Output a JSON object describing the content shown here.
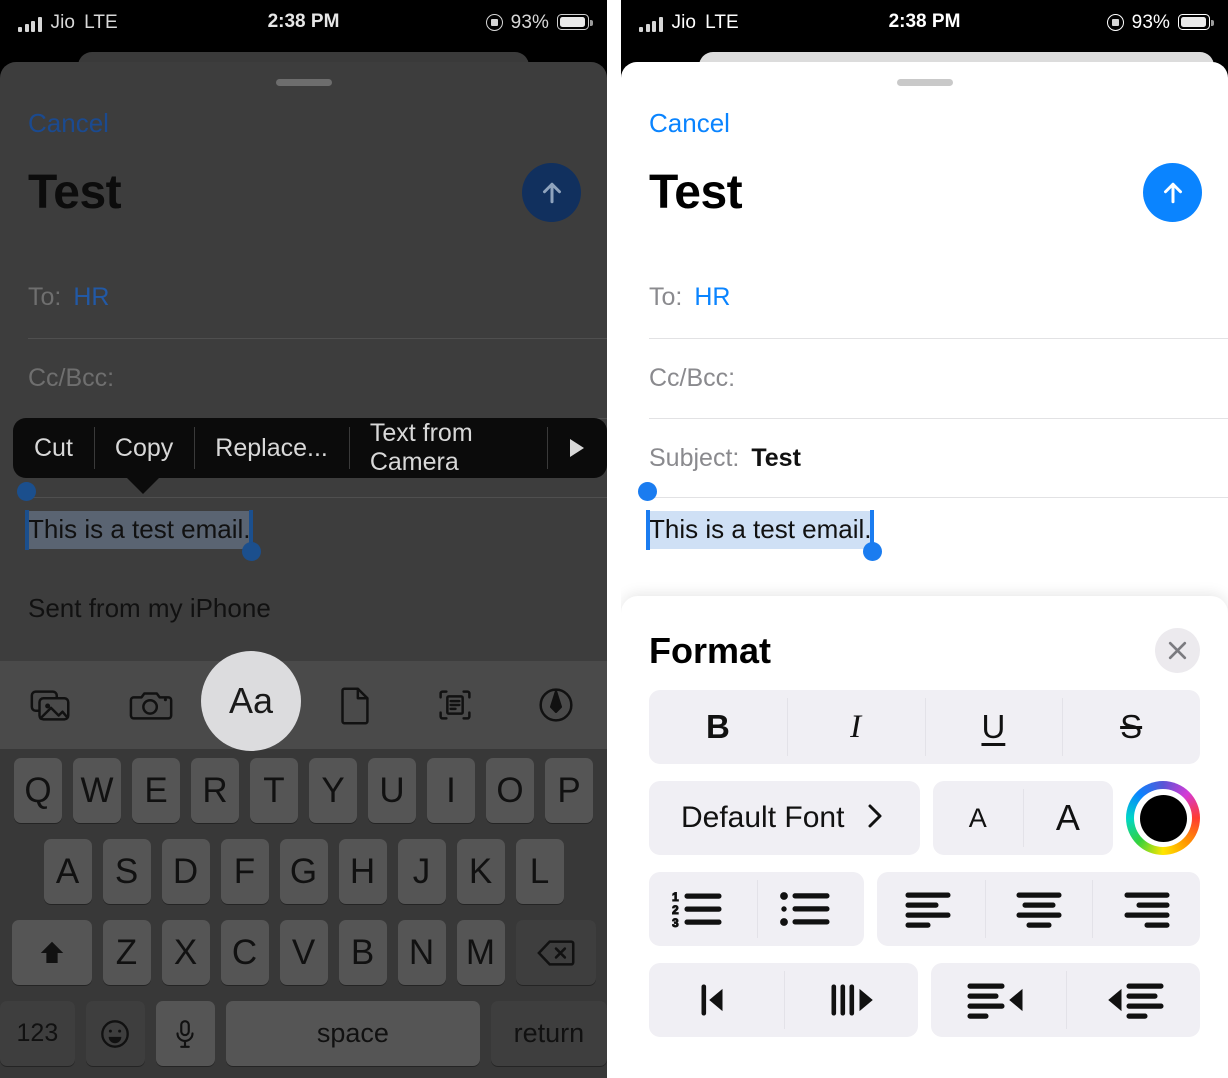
{
  "status_bar": {
    "carrier": "Jio",
    "network": "LTE",
    "time": "2:38 PM",
    "battery_percent": "93%",
    "signal_icon": "cellular-bars-icon",
    "orientation_icon": "rotation-lock-icon",
    "battery_icon": "battery-icon"
  },
  "compose": {
    "cancel_label": "Cancel",
    "title": "Test",
    "send_icon": "send-arrow-up-icon",
    "to_label": "To:",
    "to_value": "HR",
    "ccbcc_label": "Cc/Bcc:",
    "subject_label": "Subject:",
    "subject_value": "Test",
    "body_text": "This is a test email.",
    "signature": "Sent from my iPhone"
  },
  "edit_menu": {
    "items": [
      "Cut",
      "Copy",
      "Replace...",
      "Text from Camera"
    ],
    "more_icon": "triangle-right-icon"
  },
  "keyboard_toolbar": {
    "items": [
      {
        "name": "photo-library-icon",
        "label": ""
      },
      {
        "name": "camera-icon",
        "label": ""
      },
      {
        "name": "text-format-aa-icon",
        "label": "Aa"
      },
      {
        "name": "document-icon",
        "label": ""
      },
      {
        "name": "scan-document-icon",
        "label": ""
      },
      {
        "name": "markup-pen-icon",
        "label": ""
      }
    ],
    "highlighted": "Aa"
  },
  "keyboard": {
    "row1": [
      "Q",
      "W",
      "E",
      "R",
      "T",
      "Y",
      "U",
      "I",
      "O",
      "P"
    ],
    "row2": [
      "A",
      "S",
      "D",
      "F",
      "G",
      "H",
      "J",
      "K",
      "L"
    ],
    "row3": [
      "Z",
      "X",
      "C",
      "V",
      "B",
      "N",
      "M"
    ],
    "shift_icon": "shift-arrow-up-icon",
    "backspace_icon": "backspace-delete-icon",
    "numbers_key": "123",
    "emoji_icon": "emoji-smiley-icon",
    "dictation_icon": "microphone-icon",
    "space_key": "space",
    "return_key": "return"
  },
  "format_sheet": {
    "title": "Format",
    "close_icon": "close-x-icon",
    "style_row": [
      {
        "name": "bold-button",
        "label": "B"
      },
      {
        "name": "italic-button",
        "label": "I"
      },
      {
        "name": "underline-button",
        "label": "U"
      },
      {
        "name": "strikethrough-button",
        "label": "S"
      }
    ],
    "font_label": "Default Font",
    "font_chevron_icon": "chevron-right-icon",
    "size_decrease_label": "A",
    "size_increase_label": "A",
    "color_wheel_icon": "color-picker-wheel-icon",
    "color_selected": "#000000",
    "list_row": [
      {
        "name": "numbered-list-button"
      },
      {
        "name": "bulleted-list-button"
      }
    ],
    "align_row": [
      {
        "name": "align-left-button"
      },
      {
        "name": "align-center-button"
      },
      {
        "name": "align-right-button"
      }
    ],
    "indent_row": [
      {
        "name": "decrease-indent-bar-button"
      },
      {
        "name": "increase-indent-bar-button"
      },
      {
        "name": "outdent-button"
      },
      {
        "name": "indent-button"
      }
    ]
  },
  "colors": {
    "accent_blue": "#0a84ff",
    "selection_highlight": "#cfe0f5",
    "format_cell_bg": "#f0eff4",
    "dim_overlay": "#3d3d3d"
  }
}
